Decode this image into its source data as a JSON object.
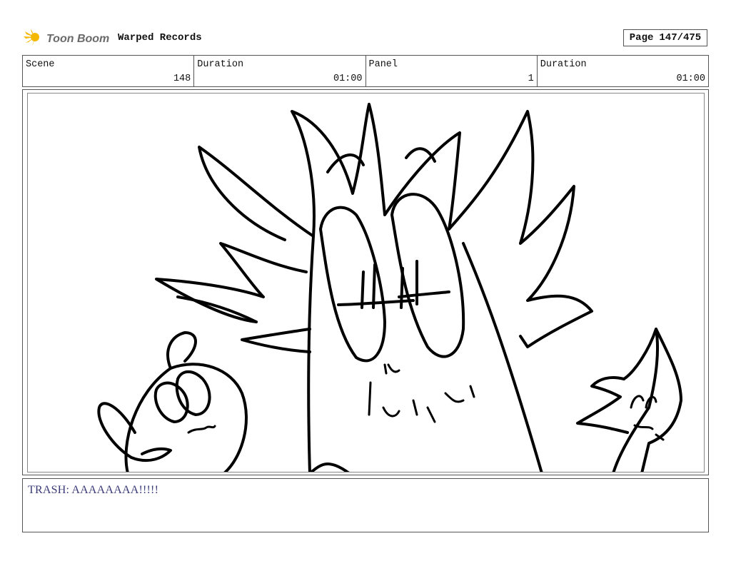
{
  "header": {
    "logo_text": "Toon Boom",
    "project_title": "Warped Records",
    "page_label": "Page",
    "page_value": "147/475"
  },
  "info": {
    "scene_label": "Scene",
    "scene_value": "148",
    "scene_duration_label": "Duration",
    "scene_duration_value": "01:00",
    "panel_label": "Panel",
    "panel_value": "1",
    "panel_duration_label": "Duration",
    "panel_duration_value": "01:00"
  },
  "dialogue": {
    "text": "TRASH: AAAAAAAA!!!!!"
  },
  "colors": {
    "logo_accent": "#f5b800",
    "dialogue_text": "#3a3a78"
  }
}
